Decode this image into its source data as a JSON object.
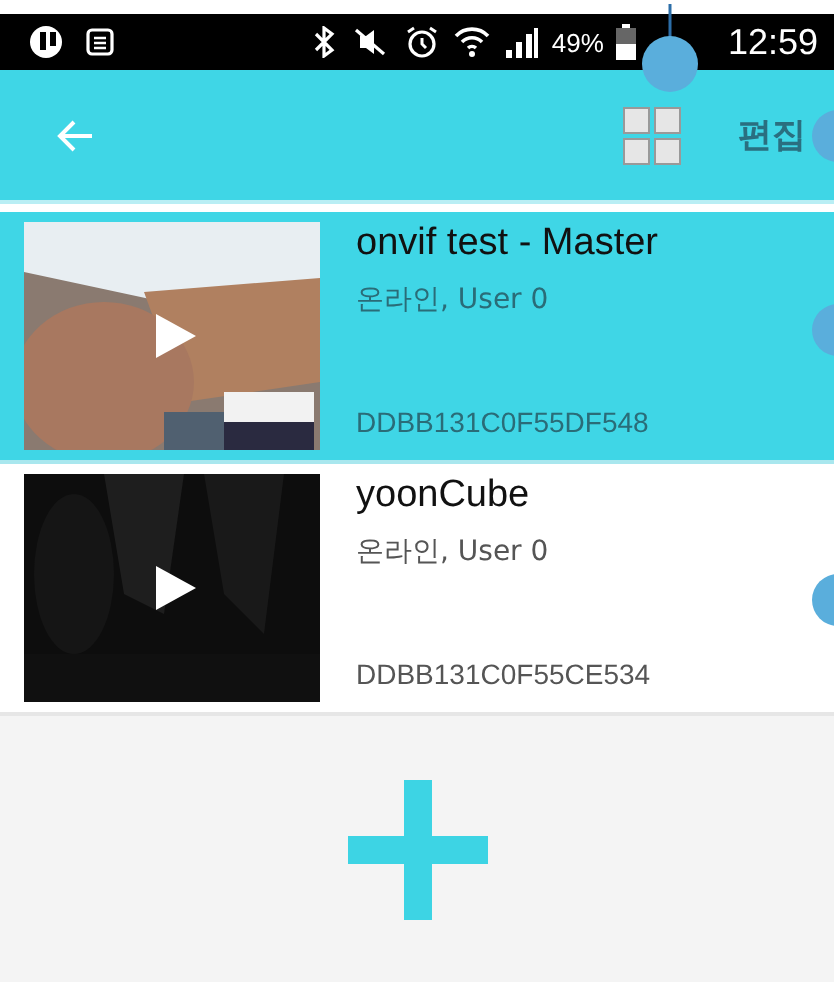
{
  "status_bar": {
    "battery_text": "49%",
    "time": "12:59"
  },
  "toolbar": {
    "edit_label": "편집"
  },
  "cameras": [
    {
      "name": "onvif test - Master",
      "status": "온라인, User 0",
      "id": "DDBB131C0F55DF548",
      "selected": true
    },
    {
      "name": "yoonCube",
      "status": "온라인, User 0",
      "id": "DDBB131C0F55CE534",
      "selected": false
    }
  ]
}
